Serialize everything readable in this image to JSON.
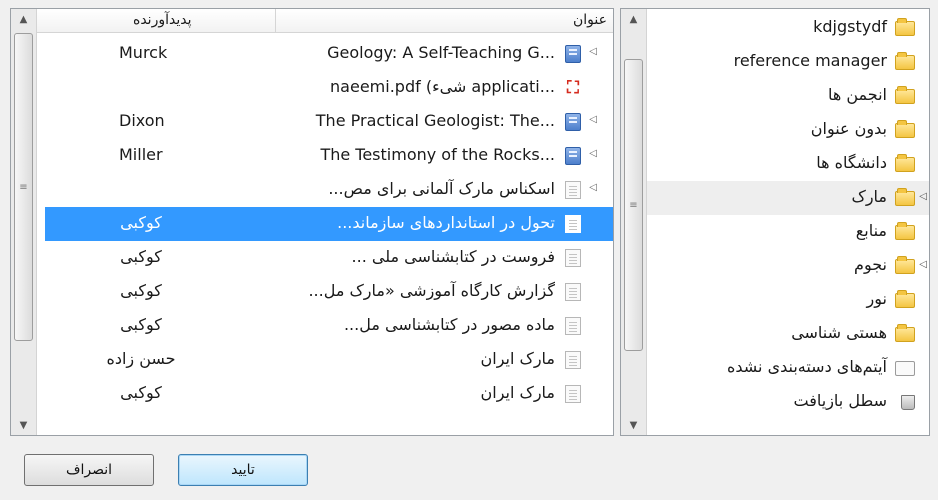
{
  "items": {
    "columns": {
      "title": "عنوان",
      "creator": "پدیدآورنده"
    },
    "rows": [
      {
        "title": "Geology: A Self-Teaching G...",
        "creator": "Murck",
        "icon": "book-icon",
        "twisty": "◁",
        "rtl": false,
        "creator_ltr": true
      },
      {
        "title": "naeemi.pdf (شیء applicati...",
        "creator": "",
        "icon": "pdf-icon",
        "twisty": "",
        "rtl": false,
        "creator_ltr": true
      },
      {
        "title": "The Practical Geologist: The...",
        "creator": "Dixon",
        "icon": "book-icon",
        "twisty": "◁",
        "rtl": false,
        "creator_ltr": true
      },
      {
        "title": "The Testimony of the Rocks...",
        "creator": "Miller",
        "icon": "book-icon",
        "twisty": "◁",
        "rtl": false,
        "creator_ltr": true
      },
      {
        "title": "اسکناس مارک آلمانی برای مص...",
        "creator": "",
        "icon": "document-icon",
        "twisty": "◁",
        "rtl": true
      },
      {
        "title": "تحول در استانداردهای سازماند...",
        "creator": "کوکبی",
        "icon": "document-icon",
        "twisty": "",
        "rtl": true,
        "selected": true
      },
      {
        "title": "فروست در کتابشناسی ملی ...",
        "creator": "کوکبی",
        "icon": "document-icon",
        "twisty": "",
        "rtl": true
      },
      {
        "title": "گزارش کارگاه آموزشی «مارک مل...",
        "creator": "کوکبی",
        "icon": "document-icon",
        "twisty": "",
        "rtl": true
      },
      {
        "title": "ماده مصور در کتابشناسی مل...",
        "creator": "کوکبی",
        "icon": "document-icon",
        "twisty": "",
        "rtl": true
      },
      {
        "title": "مارک ایران",
        "creator": "حسن زاده",
        "icon": "document-icon",
        "twisty": "",
        "rtl": true
      },
      {
        "title": "مارک ایران",
        "creator": "کوکبی",
        "icon": "document-icon",
        "twisty": "",
        "rtl": true
      }
    ]
  },
  "collections": [
    {
      "label": "kdjgstydf",
      "icon": "folder-icon",
      "twisty": "",
      "rtl": false
    },
    {
      "label": "reference manager",
      "icon": "folder-icon",
      "twisty": "",
      "rtl": false
    },
    {
      "label": "انجمن ها",
      "icon": "folder-icon",
      "twisty": "",
      "rtl": true
    },
    {
      "label": "بدون عنوان",
      "icon": "folder-icon",
      "twisty": "",
      "rtl": true
    },
    {
      "label": "دانشگاه ها",
      "icon": "folder-icon",
      "twisty": "",
      "rtl": true
    },
    {
      "label": "مارک",
      "icon": "folder-icon",
      "twisty": "◁",
      "rtl": true,
      "highlight": true
    },
    {
      "label": "منابع",
      "icon": "folder-icon",
      "twisty": "",
      "rtl": true
    },
    {
      "label": "نجوم",
      "icon": "folder-icon",
      "twisty": "◁",
      "rtl": true
    },
    {
      "label": "نور",
      "icon": "folder-icon",
      "twisty": "",
      "rtl": true
    },
    {
      "label": "هستی شناسی",
      "icon": "folder-icon",
      "twisty": "",
      "rtl": true
    },
    {
      "label": "آیتم‌های دسته‌بندی نشده",
      "icon": "unfiled-items-icon",
      "twisty": "",
      "rtl": true
    },
    {
      "label": "سطل بازیافت",
      "icon": "trash-icon",
      "twisty": "",
      "rtl": true
    }
  ],
  "buttons": {
    "ok": "تایید",
    "cancel": "انصراف"
  },
  "colors": {
    "selection": "#3399ff",
    "folder": "#f4c542"
  }
}
